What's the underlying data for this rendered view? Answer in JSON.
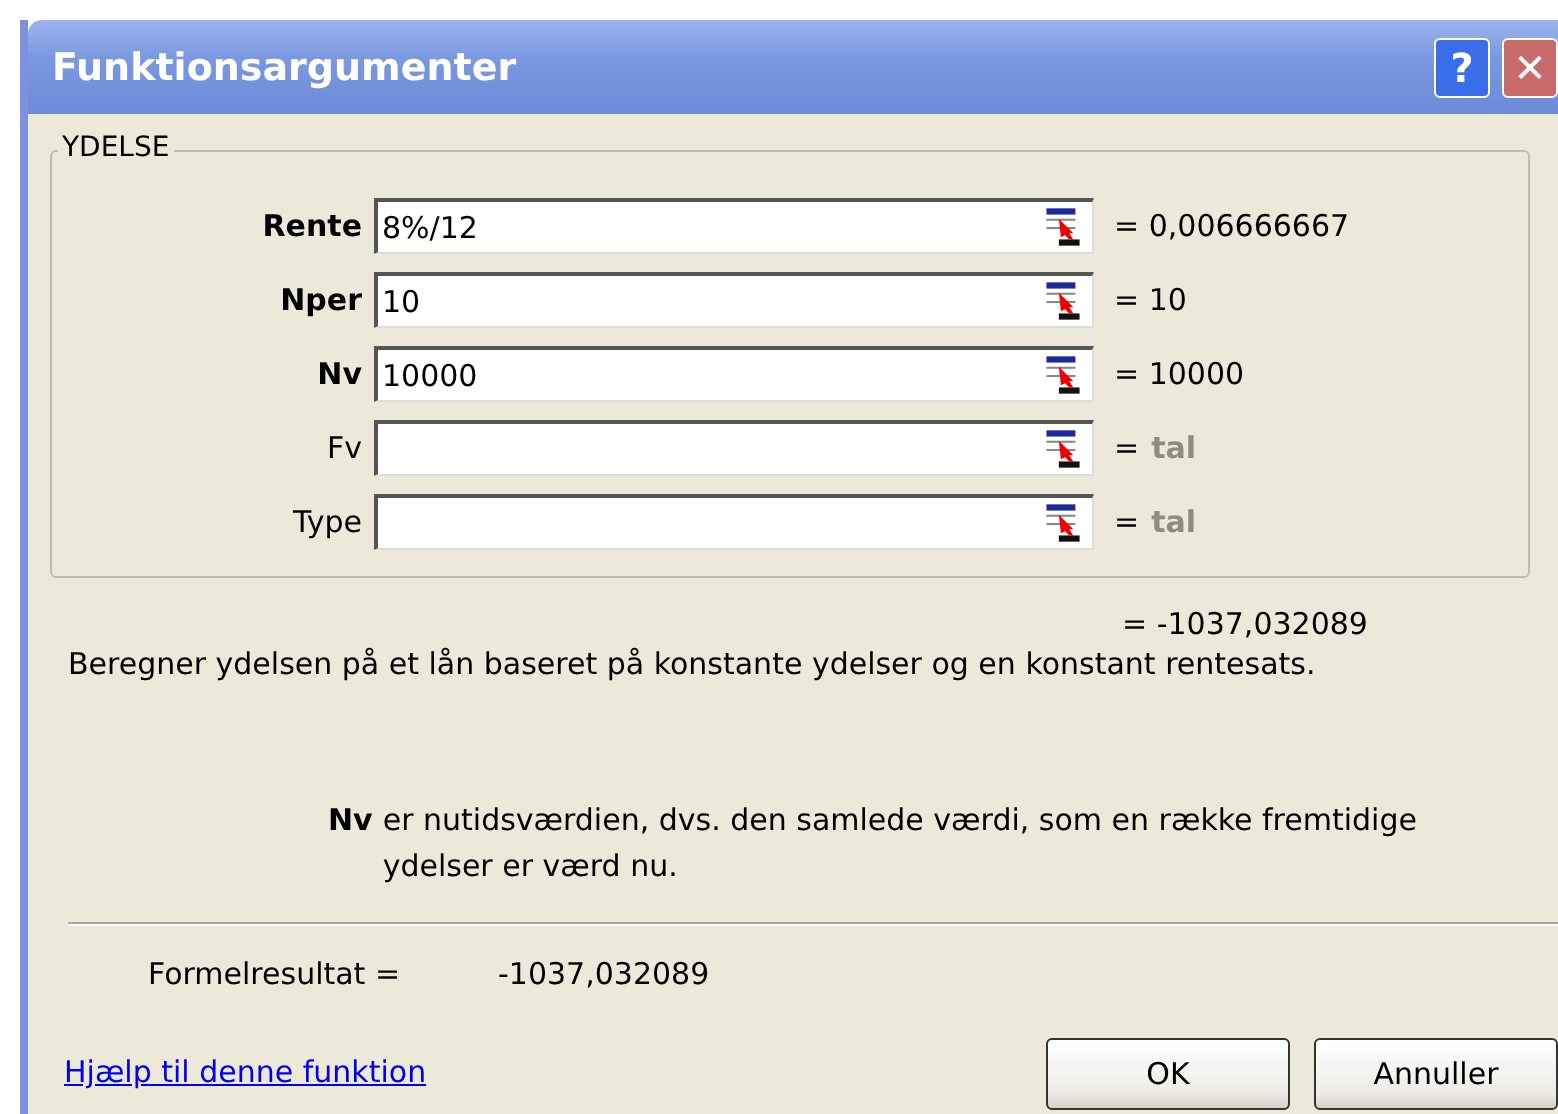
{
  "window": {
    "title": "Funktionsargumenter"
  },
  "title_buttons": [
    {
      "kind": "help",
      "label": "?"
    },
    {
      "kind": "close",
      "label": "✕"
    }
  ],
  "group": {
    "legend": "YDELSE",
    "arguments": [
      {
        "label": "Rente",
        "required": true,
        "value": "8%/12",
        "result": "= 0,006666667",
        "hint": false
      },
      {
        "label": "Nper",
        "required": true,
        "value": "10",
        "result": "= 10",
        "hint": false
      },
      {
        "label": "Nv",
        "required": true,
        "value": "10000",
        "result": "= 10000",
        "hint": false
      },
      {
        "label": "Fv",
        "required": false,
        "result_prefix": "=",
        "result": "tal",
        "hint": true
      },
      {
        "label": "Type",
        "required": false,
        "result_prefix": "=",
        "result": "tal",
        "hint": true
      }
    ]
  },
  "function_result": "= -1037,032089",
  "description": "Beregner ydelsen på et lån baseret på konstante ydelser og en konstant rentesats.",
  "argument_help": {
    "name": "Nv",
    "text": "er nutidsværdien, dvs. den samlede værdi, som en række fremtidige ydelser er værd nu."
  },
  "formula_result": {
    "label": "Formelresultat =",
    "value": "-1037,032089"
  },
  "help_link": "Hjælp til denne funktion",
  "buttons": [
    "OK",
    "Annuller"
  ]
}
